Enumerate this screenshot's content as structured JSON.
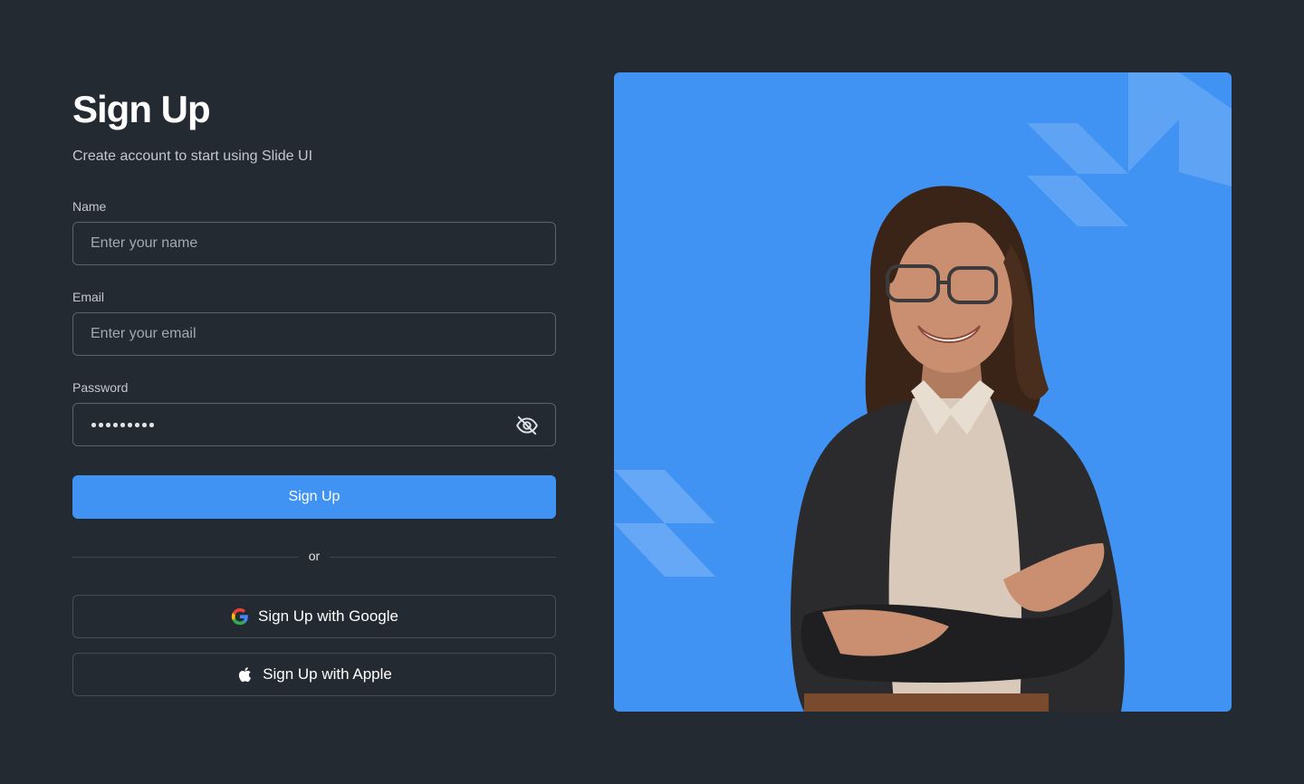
{
  "form": {
    "title": "Sign Up",
    "subtitle": "Create account to start using Slide UI",
    "name_label": "Name",
    "name_placeholder": "Enter your name",
    "name_value": "",
    "email_label": "Email",
    "email_placeholder": "Enter your email",
    "email_value": "",
    "password_label": "Password",
    "password_mask_length": 9,
    "password_toggle_icon": "eye-off-icon",
    "submit_label": "Sign Up",
    "divider_text": "or",
    "google_label": "Sign Up with Google",
    "google_icon": "google-icon",
    "apple_label": "Sign Up with Apple",
    "apple_icon": "apple-icon"
  },
  "hero": {
    "description": "Smiling woman with glasses, arms crossed, on a blue background with light chevron shapes",
    "background_color": "#4093F3"
  },
  "colors": {
    "page_background": "#242A32",
    "primary": "#4093F3",
    "border": "#5B626C",
    "muted_text": "#C3C8CF"
  }
}
